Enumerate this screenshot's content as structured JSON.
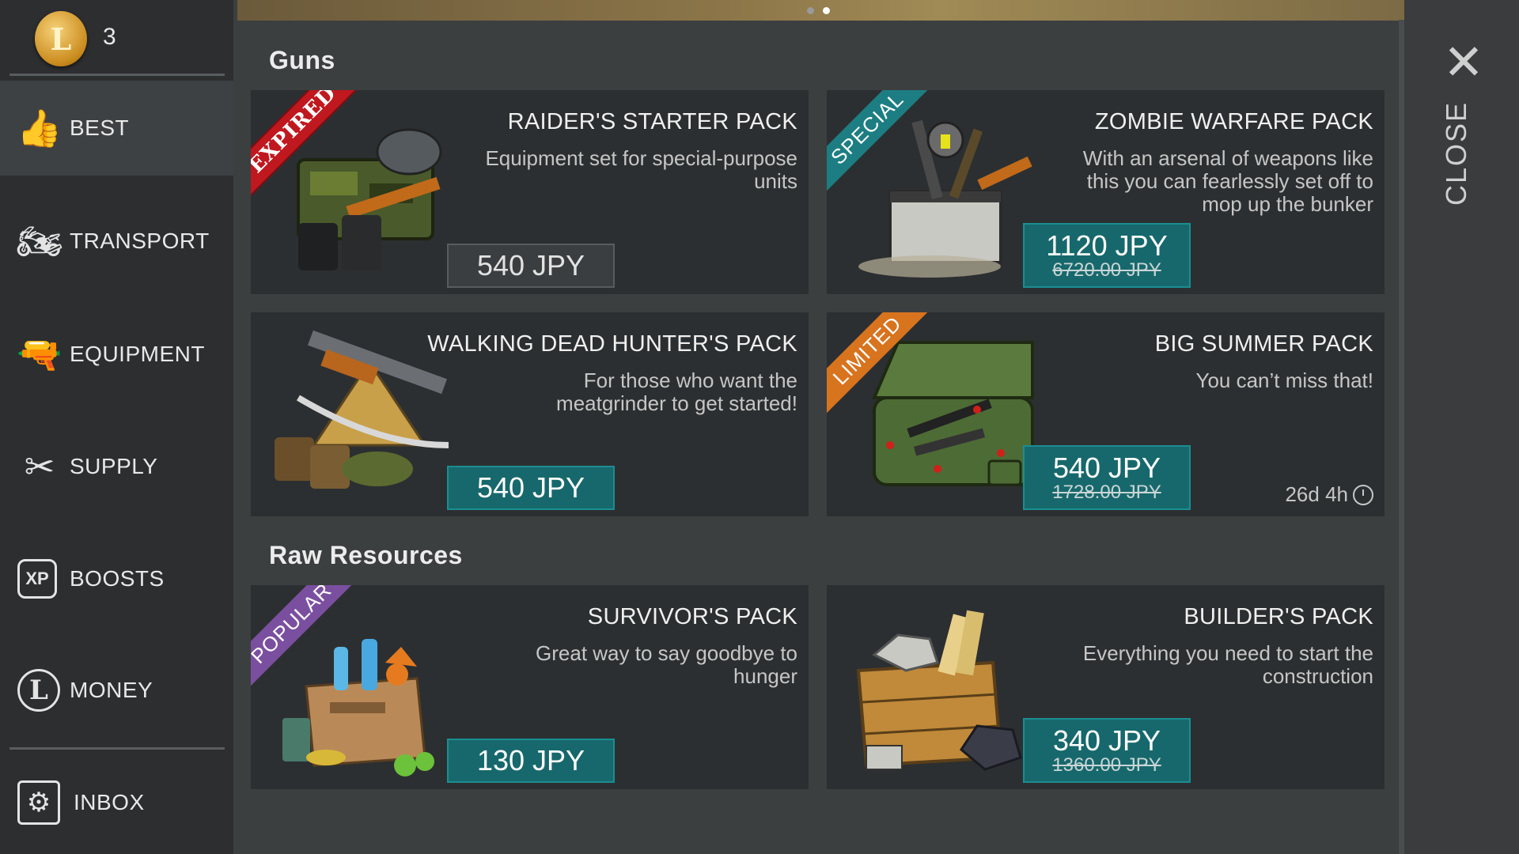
{
  "sidebar": {
    "coin_count": "3",
    "coin_symbol": "L",
    "items": [
      {
        "label": "BEST",
        "icon": "thumbs-up-icon",
        "glyph": "👍"
      },
      {
        "label": "TRANSPORT",
        "icon": "motorcycle-icon",
        "glyph": "🏍"
      },
      {
        "label": "EQUIPMENT",
        "icon": "pistol-icon",
        "glyph": "🔫"
      },
      {
        "label": "SUPPLY",
        "icon": "tools-icon",
        "glyph": "✂"
      },
      {
        "label": "BOOSTS",
        "icon": "xp-boost-icon",
        "glyph": "XP"
      },
      {
        "label": "MONEY",
        "icon": "coin-icon",
        "glyph": "L"
      },
      {
        "label": "INBOX",
        "icon": "inbox-icon",
        "glyph": "⚙"
      }
    ]
  },
  "sections": {
    "guns": "Guns",
    "raw": "Raw Resources"
  },
  "cards": [
    {
      "title": "RAIDER'S STARTER PACK",
      "desc": "Equipment set for special-purpose units",
      "price": "540 JPY",
      "old_price": "",
      "ribbon": "EXPIRED",
      "ribbon_color": "#c0181f"
    },
    {
      "title": "ZOMBIE WARFARE PACK",
      "desc": "With an arsenal of weapons like this you can fearlessly set off to mop up the bunker",
      "price": "1120 JPY",
      "old_price": "6720.00 JPY",
      "ribbon": "SPECIAL",
      "ribbon_color": "#1c7e82"
    },
    {
      "title": "WALKING DEAD HUNTER'S PACK",
      "desc": "For those who want the meatgrinder to get started!",
      "price": "540 JPY",
      "old_price": "",
      "ribbon": "",
      "ribbon_color": ""
    },
    {
      "title": "BIG SUMMER PACK",
      "desc": "You can’t miss that!",
      "price": "540 JPY",
      "old_price": "1728.00 JPY",
      "ribbon": "LIMITED",
      "ribbon_color": "#d8731e",
      "timer": "26d 4h"
    },
    {
      "title": "SURVIVOR'S PACK",
      "desc": "Great way to say goodbye to hunger",
      "price": "130 JPY",
      "old_price": "",
      "ribbon": "POPULAR",
      "ribbon_color": "#7b4fa0"
    },
    {
      "title": "BUILDER'S PACK",
      "desc": "Everything you need to start the construction",
      "price": "340 JPY",
      "old_price": "1360.00 JPY",
      "ribbon": "",
      "ribbon_color": ""
    }
  ],
  "close": {
    "label": "CLOSE"
  }
}
